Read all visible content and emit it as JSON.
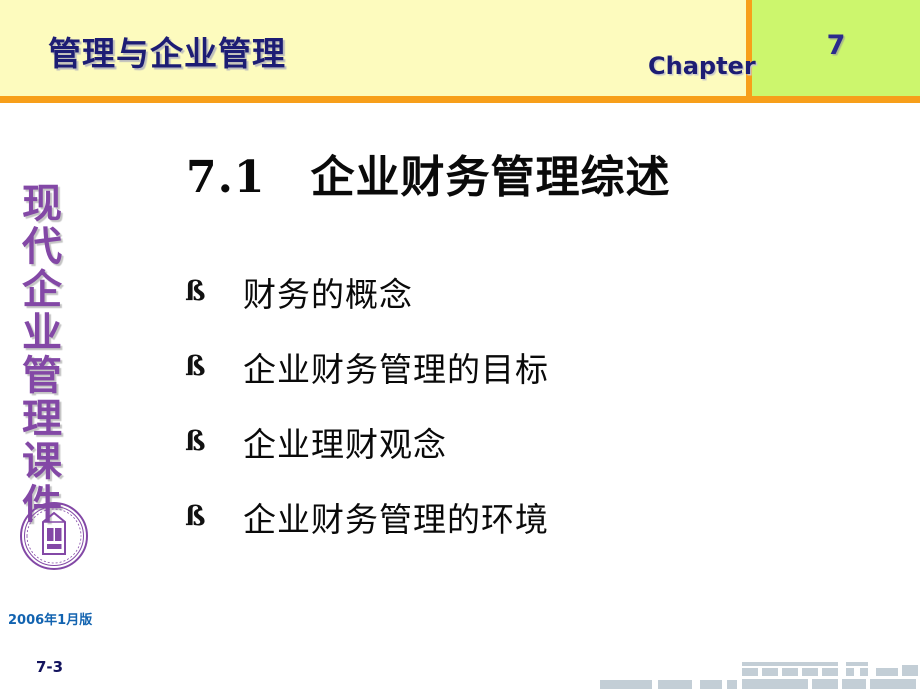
{
  "header": {
    "title": "管理与企业管理",
    "chapter_label": "Chapter",
    "chapter_number": "7",
    "band_color": "#fdfbbe",
    "rule_color": "#f79f1a",
    "panel_color": "#ccf66d",
    "title_color": "#1d1d74"
  },
  "sidebar": {
    "vertical_title": "现代企业管理课件",
    "vertical_title_color": "#8348a6",
    "logo_name": "tsinghua-university-press-logo",
    "logo_color": "#8348a6"
  },
  "main": {
    "section_number": "7.1",
    "title": "7.1　企业财务管理综述",
    "title_color": "#0a0a0a",
    "bullet_marker": "ß",
    "bullets": [
      {
        "text": "财务的概念"
      },
      {
        "text": "企业财务管理的目标"
      },
      {
        "text": "企业理财观念"
      },
      {
        "text": "企业财务管理的环境"
      }
    ]
  },
  "footer": {
    "date": "2006年1月版",
    "date_color": "#1263b0",
    "slide_number": "7-3",
    "slide_number_color": "#13135e",
    "decoration_color": "#c3ced6"
  }
}
